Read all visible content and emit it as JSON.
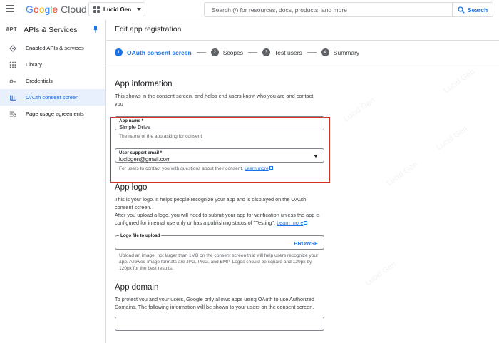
{
  "topbar": {
    "logo_text": "Google Cloud",
    "project_name": "Lucid Gen",
    "search_placeholder": "Search (/) for resources, docs, products, and more",
    "search_button": "Search"
  },
  "sidebar": {
    "badge": "API",
    "title": "APIs & Services",
    "items": [
      {
        "label": "Enabled APIs & services",
        "icon": "diamond-icon"
      },
      {
        "label": "Library",
        "icon": "library-icon"
      },
      {
        "label": "Credentials",
        "icon": "key-icon"
      },
      {
        "label": "OAuth consent screen",
        "icon": "consent-icon",
        "active": true
      },
      {
        "label": "Page usage agreements",
        "icon": "settings-list-icon"
      }
    ]
  },
  "main": {
    "page_title": "Edit app registration",
    "steps": [
      {
        "num": "1",
        "label": "OAuth consent screen",
        "active": true
      },
      {
        "num": "2",
        "label": "Scopes"
      },
      {
        "num": "3",
        "label": "Test users"
      },
      {
        "num": "4",
        "label": "Summary"
      }
    ],
    "app_info": {
      "heading": "App information",
      "desc": "This shows in the consent screen, and helps end users know who you are and contact you",
      "app_name_label": "App name *",
      "app_name_value": "Simple Drive",
      "app_name_hint": "The name of the app asking for consent",
      "email_label": "User support email *",
      "email_value": "lucidgen@gmail.com",
      "email_hint": "For users to contact you with questions about their consent.",
      "learn_more": "Learn more"
    },
    "app_logo": {
      "heading": "App logo",
      "desc1": "This is your logo. It helps people recognize your app and is displayed on the OAuth consent screen.",
      "desc2": "After you upload a logo, you will need to submit your app for verification unless the app is configured for internal use only or has a publishing status of \"Testing\".",
      "learn_more": "Learn more",
      "upload_label": "Logo file to upload",
      "browse": "BROWSE",
      "upload_hint": "Upload an image, not larger than 1MB on the consent screen that will help users recognize your app. Allowed image formats are JPG, PNG, and BMP. Logos should be square and 120px by 120px for the best results."
    },
    "app_domain": {
      "heading": "App domain",
      "desc": "To protect you and your users, Google only allows apps using OAuth to use Authorized Domains. The following information will be shown to your users on the consent screen."
    }
  },
  "watermark": "Lucid Gen"
}
